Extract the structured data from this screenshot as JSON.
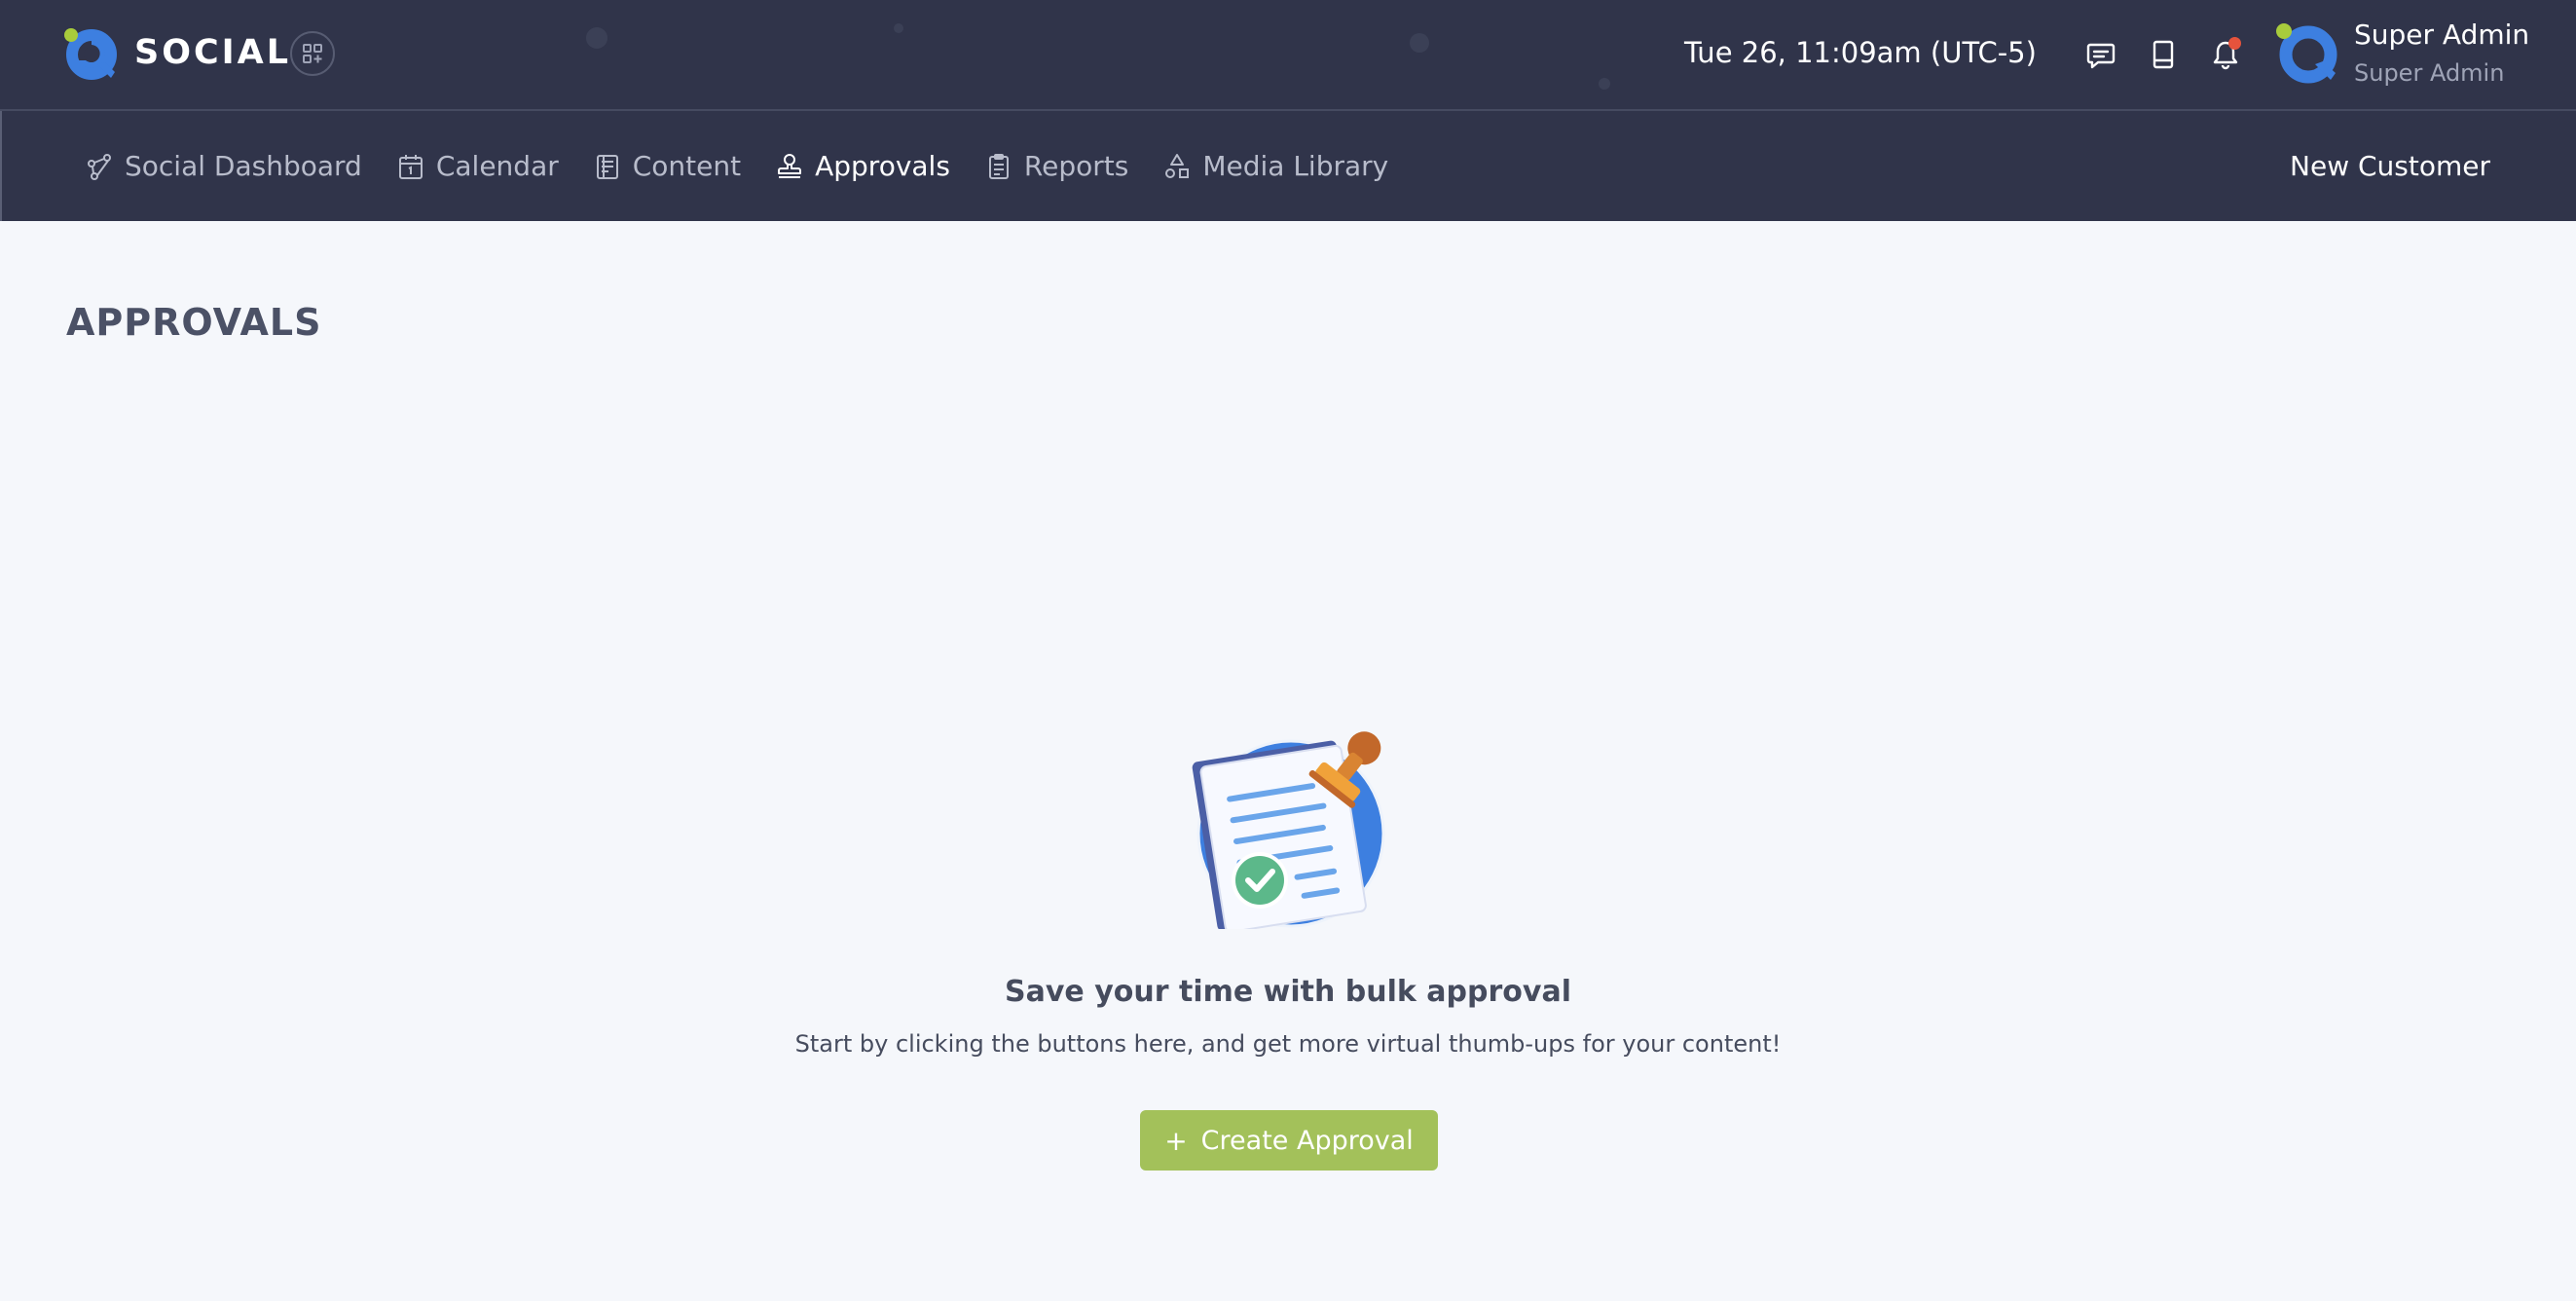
{
  "header": {
    "brand": "SOCIAL",
    "datetime": "Tue 26, 11:09am (UTC-5)",
    "icons": [
      "logo-icon",
      "apps-grid-icon",
      "chat-icon",
      "book-icon",
      "bell-icon"
    ],
    "notification_dot_color": "#e6533c",
    "user": {
      "name": "Super Admin",
      "role": "Super Admin"
    }
  },
  "nav": {
    "items": [
      {
        "label": "Social Dashboard",
        "icon": "social-network-icon",
        "active": false
      },
      {
        "label": "Calendar",
        "icon": "calendar-icon",
        "active": false
      },
      {
        "label": "Content",
        "icon": "document-icon",
        "active": false
      },
      {
        "label": "Approvals",
        "icon": "stamp-icon",
        "active": true
      },
      {
        "label": "Reports",
        "icon": "clipboard-icon",
        "active": false
      },
      {
        "label": "Media Library",
        "icon": "shapes-icon",
        "active": false
      }
    ],
    "right_link": "New Customer"
  },
  "page": {
    "title": "APPROVALS"
  },
  "empty_state": {
    "heading": "Save your time with bulk approval",
    "subtext": "Start by clicking the buttons here, and get more virtual thumb-ups for your content!",
    "button_icon": "+",
    "button_label": "Create Approval"
  },
  "colors": {
    "header_bg": "#30344a",
    "page_bg": "#f5f7fb",
    "accent_green": "#a3c15a",
    "brand_blue": "#3d7fe0",
    "brand_lime": "#a8cc3c"
  }
}
